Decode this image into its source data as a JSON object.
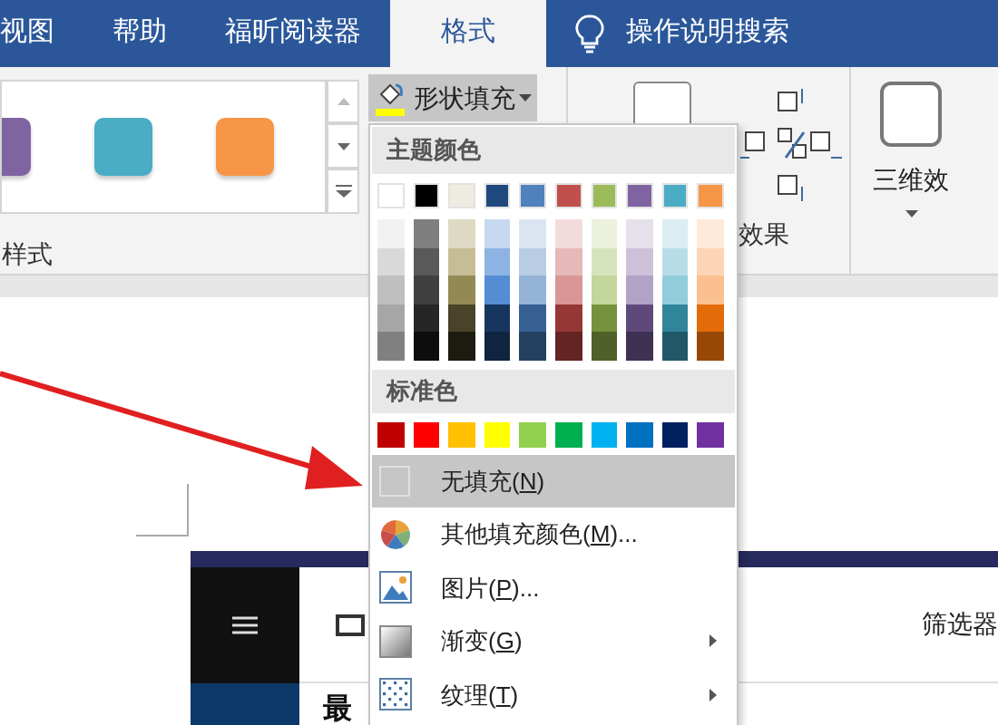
{
  "tabs": [
    {
      "label": "视图",
      "selected": false
    },
    {
      "label": "帮助",
      "selected": false
    },
    {
      "label": "福昕阅读器",
      "selected": false
    },
    {
      "label": "格式",
      "selected": true
    }
  ],
  "search": {
    "label": "操作说明搜索"
  },
  "ribbon": {
    "gallery": [
      {
        "color": "#8064a2"
      },
      {
        "color": "#4bacc6"
      },
      {
        "color": "#f79646"
      }
    ],
    "gallery_label": "样式",
    "fill_button": {
      "label": "形状填充",
      "color": "#ffff00"
    },
    "effects_label": "效果",
    "three_d": {
      "label": "三维效"
    }
  },
  "fill_menu": {
    "theme_header": "主题颜色",
    "theme_colors": [
      {
        "color": "#ffffff"
      },
      {
        "color": "#000000"
      },
      {
        "color": "#eeece1"
      },
      {
        "color": "#1f497d"
      },
      {
        "color": "#4f81bd"
      },
      {
        "color": "#c0504d"
      },
      {
        "color": "#9bbb59"
      },
      {
        "color": "#8064a2"
      },
      {
        "color": "#4bacc6"
      },
      {
        "color": "#f79646"
      }
    ],
    "shade_columns": [
      {
        "shades": [
          {
            "color": "#f2f2f2"
          },
          {
            "color": "#d9d9d9"
          },
          {
            "color": "#bfbfbf"
          },
          {
            "color": "#a6a6a6"
          },
          {
            "color": "#808080"
          }
        ]
      },
      {
        "shades": [
          {
            "color": "#7f7f7f"
          },
          {
            "color": "#595959"
          },
          {
            "color": "#3f3f3f"
          },
          {
            "color": "#262626"
          },
          {
            "color": "#0d0d0d"
          }
        ]
      },
      {
        "shades": [
          {
            "color": "#ddd9c3"
          },
          {
            "color": "#c4bd97"
          },
          {
            "color": "#938953"
          },
          {
            "color": "#494429"
          },
          {
            "color": "#1d1b10"
          }
        ]
      },
      {
        "shades": [
          {
            "color": "#c6d9f0"
          },
          {
            "color": "#8db3e2"
          },
          {
            "color": "#548dd4"
          },
          {
            "color": "#17365d"
          },
          {
            "color": "#0f243e"
          }
        ]
      },
      {
        "shades": [
          {
            "color": "#dbe5f1"
          },
          {
            "color": "#b8cce4"
          },
          {
            "color": "#95b3d7"
          },
          {
            "color": "#366092"
          },
          {
            "color": "#244061"
          }
        ]
      },
      {
        "shades": [
          {
            "color": "#f2dcdb"
          },
          {
            "color": "#e5b9b7"
          },
          {
            "color": "#d99694"
          },
          {
            "color": "#953734"
          },
          {
            "color": "#632423"
          }
        ]
      },
      {
        "shades": [
          {
            "color": "#ebf1dd"
          },
          {
            "color": "#d7e3bc"
          },
          {
            "color": "#c3d69b"
          },
          {
            "color": "#76923c"
          },
          {
            "color": "#4f6128"
          }
        ]
      },
      {
        "shades": [
          {
            "color": "#e5e0ec"
          },
          {
            "color": "#ccc1d9"
          },
          {
            "color": "#b2a2c7"
          },
          {
            "color": "#5f497a"
          },
          {
            "color": "#3f3151"
          }
        ]
      },
      {
        "shades": [
          {
            "color": "#dbeef3"
          },
          {
            "color": "#b7dde8"
          },
          {
            "color": "#92cddc"
          },
          {
            "color": "#31859b"
          },
          {
            "color": "#205867"
          }
        ]
      },
      {
        "shades": [
          {
            "color": "#fdeada"
          },
          {
            "color": "#fbd5b5"
          },
          {
            "color": "#fac08f"
          },
          {
            "color": "#e36c09"
          },
          {
            "color": "#974806"
          }
        ]
      }
    ],
    "standard_header": "标准色",
    "standard_colors": [
      {
        "color": "#c00000"
      },
      {
        "color": "#ff0000"
      },
      {
        "color": "#ffc000"
      },
      {
        "color": "#ffff00"
      },
      {
        "color": "#92d050"
      },
      {
        "color": "#00b050"
      },
      {
        "color": "#00b0f0"
      },
      {
        "color": "#0070c0"
      },
      {
        "color": "#002060"
      },
      {
        "color": "#7030a0"
      }
    ],
    "items": [
      {
        "kind": "no_fill",
        "text": "无填充(",
        "key": "N",
        "after": ")",
        "highlighted": true,
        "submenu": false
      },
      {
        "kind": "more_colors",
        "text": "其他填充颜色(",
        "key": "M",
        "after": ")...",
        "highlighted": false,
        "submenu": false
      },
      {
        "kind": "picture",
        "text": "图片(",
        "key": "P",
        "after": ")...",
        "highlighted": false,
        "submenu": false
      },
      {
        "kind": "gradient",
        "text": "渐变(",
        "key": "G",
        "after": ")",
        "highlighted": false,
        "submenu": true
      },
      {
        "kind": "texture",
        "text": "纹理(",
        "key": "T",
        "after": ")",
        "highlighted": false,
        "submenu": true
      }
    ]
  },
  "embedded": {
    "filter_label": "筛选器",
    "heading": "最"
  }
}
